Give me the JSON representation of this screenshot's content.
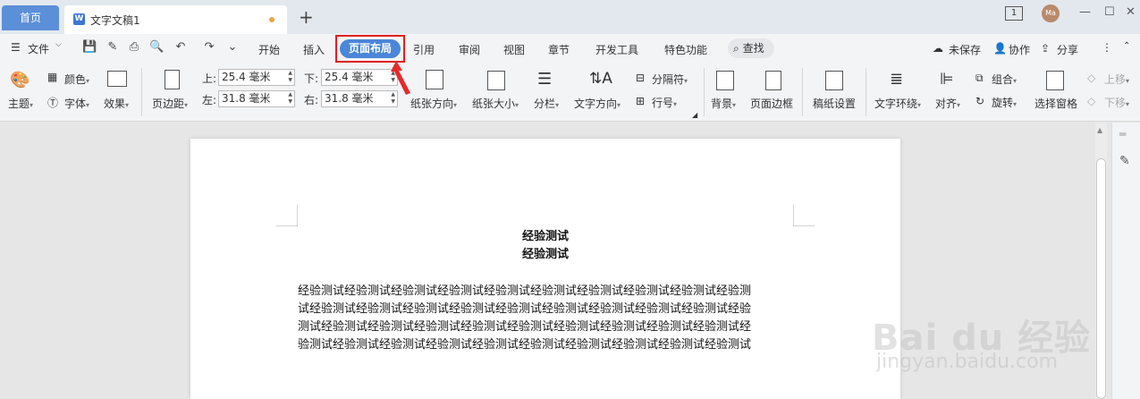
{
  "titlebar": {
    "home_tab": "首页",
    "doc_tab": "文字文稿1",
    "new_tab": "+",
    "window_badge": "1",
    "avatar": "Ma"
  },
  "menu": {
    "file": "文件",
    "items": [
      "开始",
      "插入",
      "页面布局",
      "引用",
      "审阅",
      "视图",
      "章节",
      "开发工具",
      "特色功能"
    ],
    "search": "查找",
    "right": [
      "未保存",
      "协作",
      "分享"
    ]
  },
  "ribbon": {
    "theme": "主题",
    "color": "颜色",
    "font": "字体",
    "effect": "效果",
    "margins": "页边距",
    "top_label": "上:",
    "top_value": "25.4 毫米",
    "bottom_label": "下:",
    "bottom_value": "25.4 毫米",
    "left_label": "左:",
    "left_value": "31.8 毫米",
    "right_label": "右:",
    "right_value": "31.8 毫米",
    "orientation": "纸张方向",
    "size": "纸张大小",
    "columns": "分栏",
    "text_direction": "文字方向",
    "breaks": "分隔符",
    "line_numbers": "行号",
    "background": "背景",
    "page_border": "页面边框",
    "draft_settings": "稿纸设置",
    "text_wrap": "文字环绕",
    "align": "对齐",
    "group": "组合",
    "rotate": "旋转",
    "selection_pane": "选择窗格",
    "bring_forward": "上移",
    "send_backward": "下移"
  },
  "document": {
    "heading1": "经验测试",
    "heading2": "经验测试",
    "body_lines": [
      "经验测试经验测试经验测试经验测试经验测试经验测试经验测试经验测试经验测试经验测",
      "试经验测试经验测试经验测试经验测试经验测试经验测试经验测试经验测试经验测试经验",
      "测试经验测试经验测试经验测试经验测试经验测试经验测试经验测试经验测试经验测试经",
      "验测试经验测试经验测试经验测试经验测试经验测试经验测试经验测试经验测试经验测试"
    ]
  },
  "watermark": {
    "brand": "Bai du 经验",
    "url": "jingyan.baidu.com"
  },
  "colors": {
    "accent": "#4a86d9",
    "highlight_box": "#e02020",
    "home_tab": "#5b8fd8"
  }
}
